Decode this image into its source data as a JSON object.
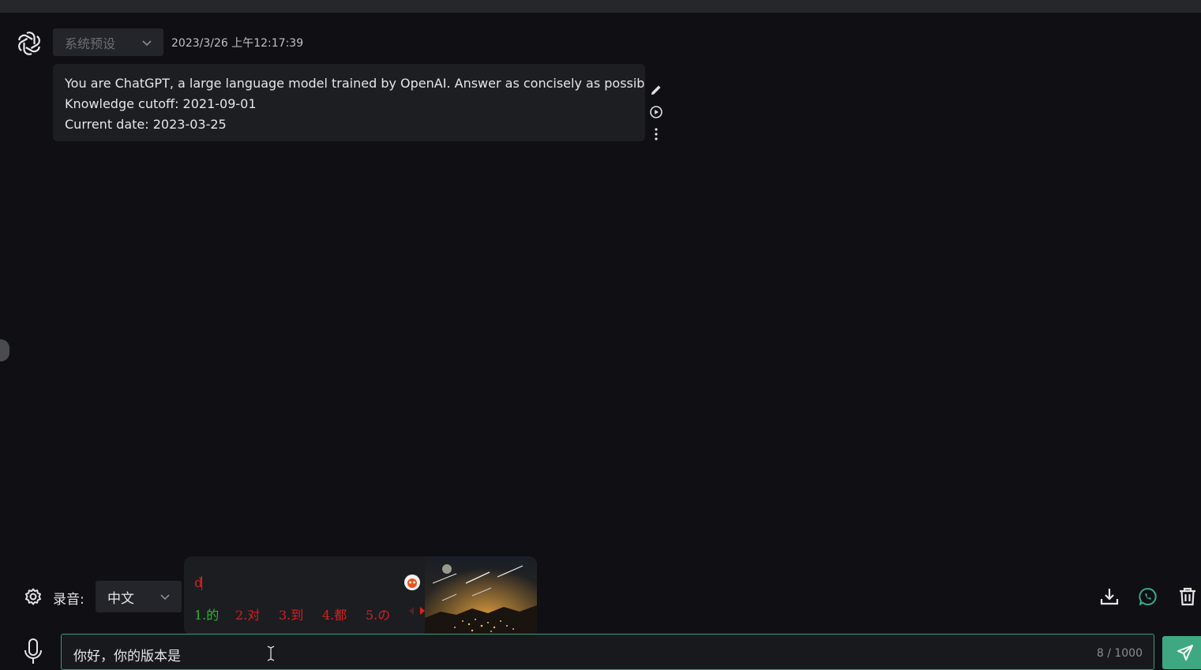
{
  "message": {
    "role": "系统预设",
    "time": "2023/3/26 上午12:17:39",
    "lines": [
      "You are ChatGPT, a large language model trained by OpenAI. Answer as concisely as possible.",
      "Knowledge cutoff: 2021-09-01",
      "Current date: 2023-03-25"
    ],
    "actions": [
      "edit-icon",
      "play-circle-icon",
      "more-vertical-icon"
    ]
  },
  "toolbar": {
    "settings_icon": "gear-icon",
    "recording_label": "录音:",
    "language": "中文",
    "right_icons": [
      "download-icon",
      "whatsapp-icon",
      "trash-icon"
    ]
  },
  "ime": {
    "composition": "d",
    "candidates": [
      "1.的",
      "2.对",
      "3.到",
      "4.都",
      "5.の"
    ]
  },
  "input": {
    "value": "你好，你的版本是",
    "counter": "8 / 1000"
  },
  "colors": {
    "accent": "#3ea882",
    "background": "#101014",
    "bubble": "#1d1e22",
    "ime_first": "#28b828",
    "ime_other": "#d42020"
  }
}
